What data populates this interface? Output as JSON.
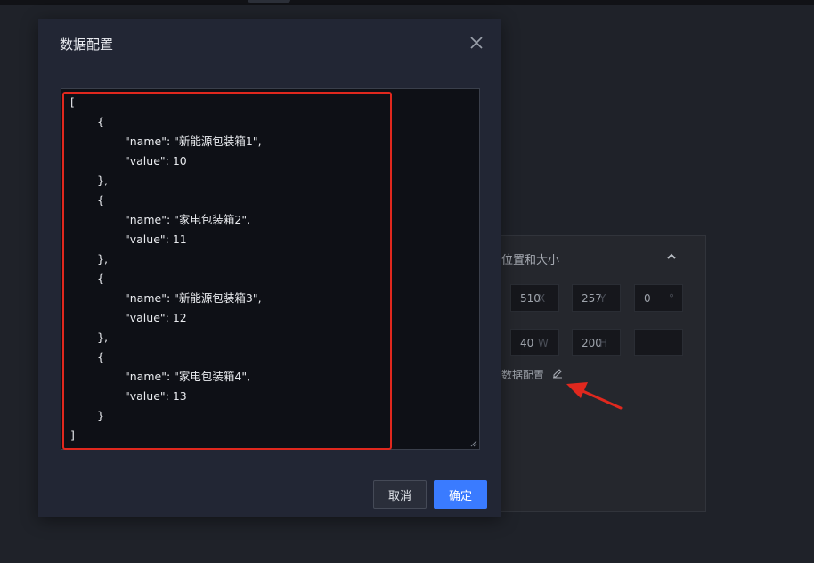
{
  "panel": {
    "title": "位置和大小",
    "fields": [
      {
        "value": "510",
        "unit": "X"
      },
      {
        "value": "257",
        "unit": "Y"
      },
      {
        "value": "0",
        "unit": "°"
      },
      {
        "value": "40",
        "unit": "W"
      },
      {
        "value": "200",
        "unit": "H"
      },
      {
        "value": "",
        "unit": ""
      }
    ],
    "data_config_label": "数据配置"
  },
  "modal": {
    "title": "数据配置",
    "editor_lines": [
      "[",
      "{",
      "\"name\": \"新能源包装箱1\",",
      "\"value\": 10",
      "},",
      "{",
      "\"name\": \"家电包装箱2\",",
      "\"value\": 11",
      "},",
      "{",
      "\"name\": \"新能源包装箱3\",",
      "\"value\": 12",
      "},",
      "{",
      "\"name\": \"家电包装箱4\",",
      "\"value\": 13",
      "}",
      "]"
    ],
    "cancel_label": "取消",
    "confirm_label": "确定"
  },
  "colors": {
    "accent": "#3a7bff",
    "highlight": "#e0281e",
    "modal_bg": "#222634",
    "editor_bg": "#0e1016"
  }
}
